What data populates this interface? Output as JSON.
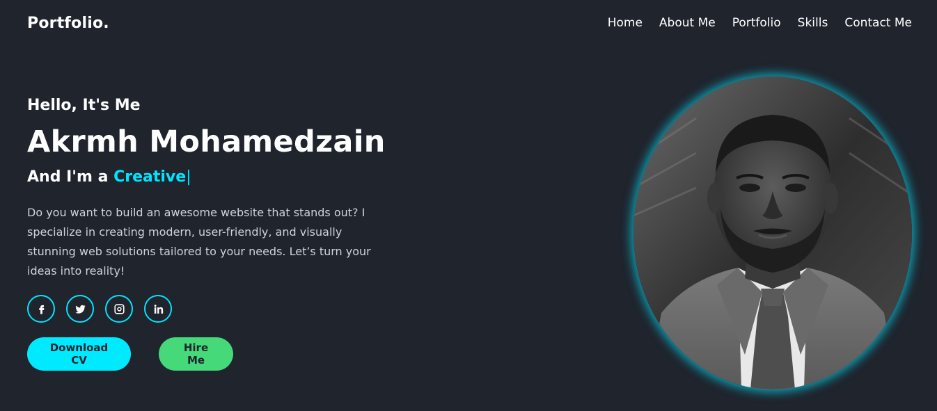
{
  "header": {
    "logo": "Portfolio.",
    "nav": [
      {
        "label": "Home"
      },
      {
        "label": "About Me"
      },
      {
        "label": "Portfolio"
      },
      {
        "label": "Skills"
      },
      {
        "label": "Contact Me"
      }
    ]
  },
  "hero": {
    "greeting": "Hello, It's Me",
    "name": "Akrmh Mohamedzain",
    "role_prefix": "And I'm a ",
    "role_highlight": "Creative",
    "caret": "|",
    "description": "Do you want to build an awesome website that stands out? I specialize in creating modern, user-friendly, and visually stunning web solutions tailored to your needs. Let’s turn your ideas into reality!",
    "socials": [
      {
        "icon": "facebook-icon"
      },
      {
        "icon": "twitter-icon"
      },
      {
        "icon": "instagram-icon"
      },
      {
        "icon": "linkedin-icon"
      }
    ],
    "buttons": {
      "download_cv": "Download CV",
      "hire_me": "Hire Me"
    }
  },
  "colors": {
    "background": "#1f242d",
    "accent": "#00e5ff",
    "hire_button": "#45d97a"
  }
}
